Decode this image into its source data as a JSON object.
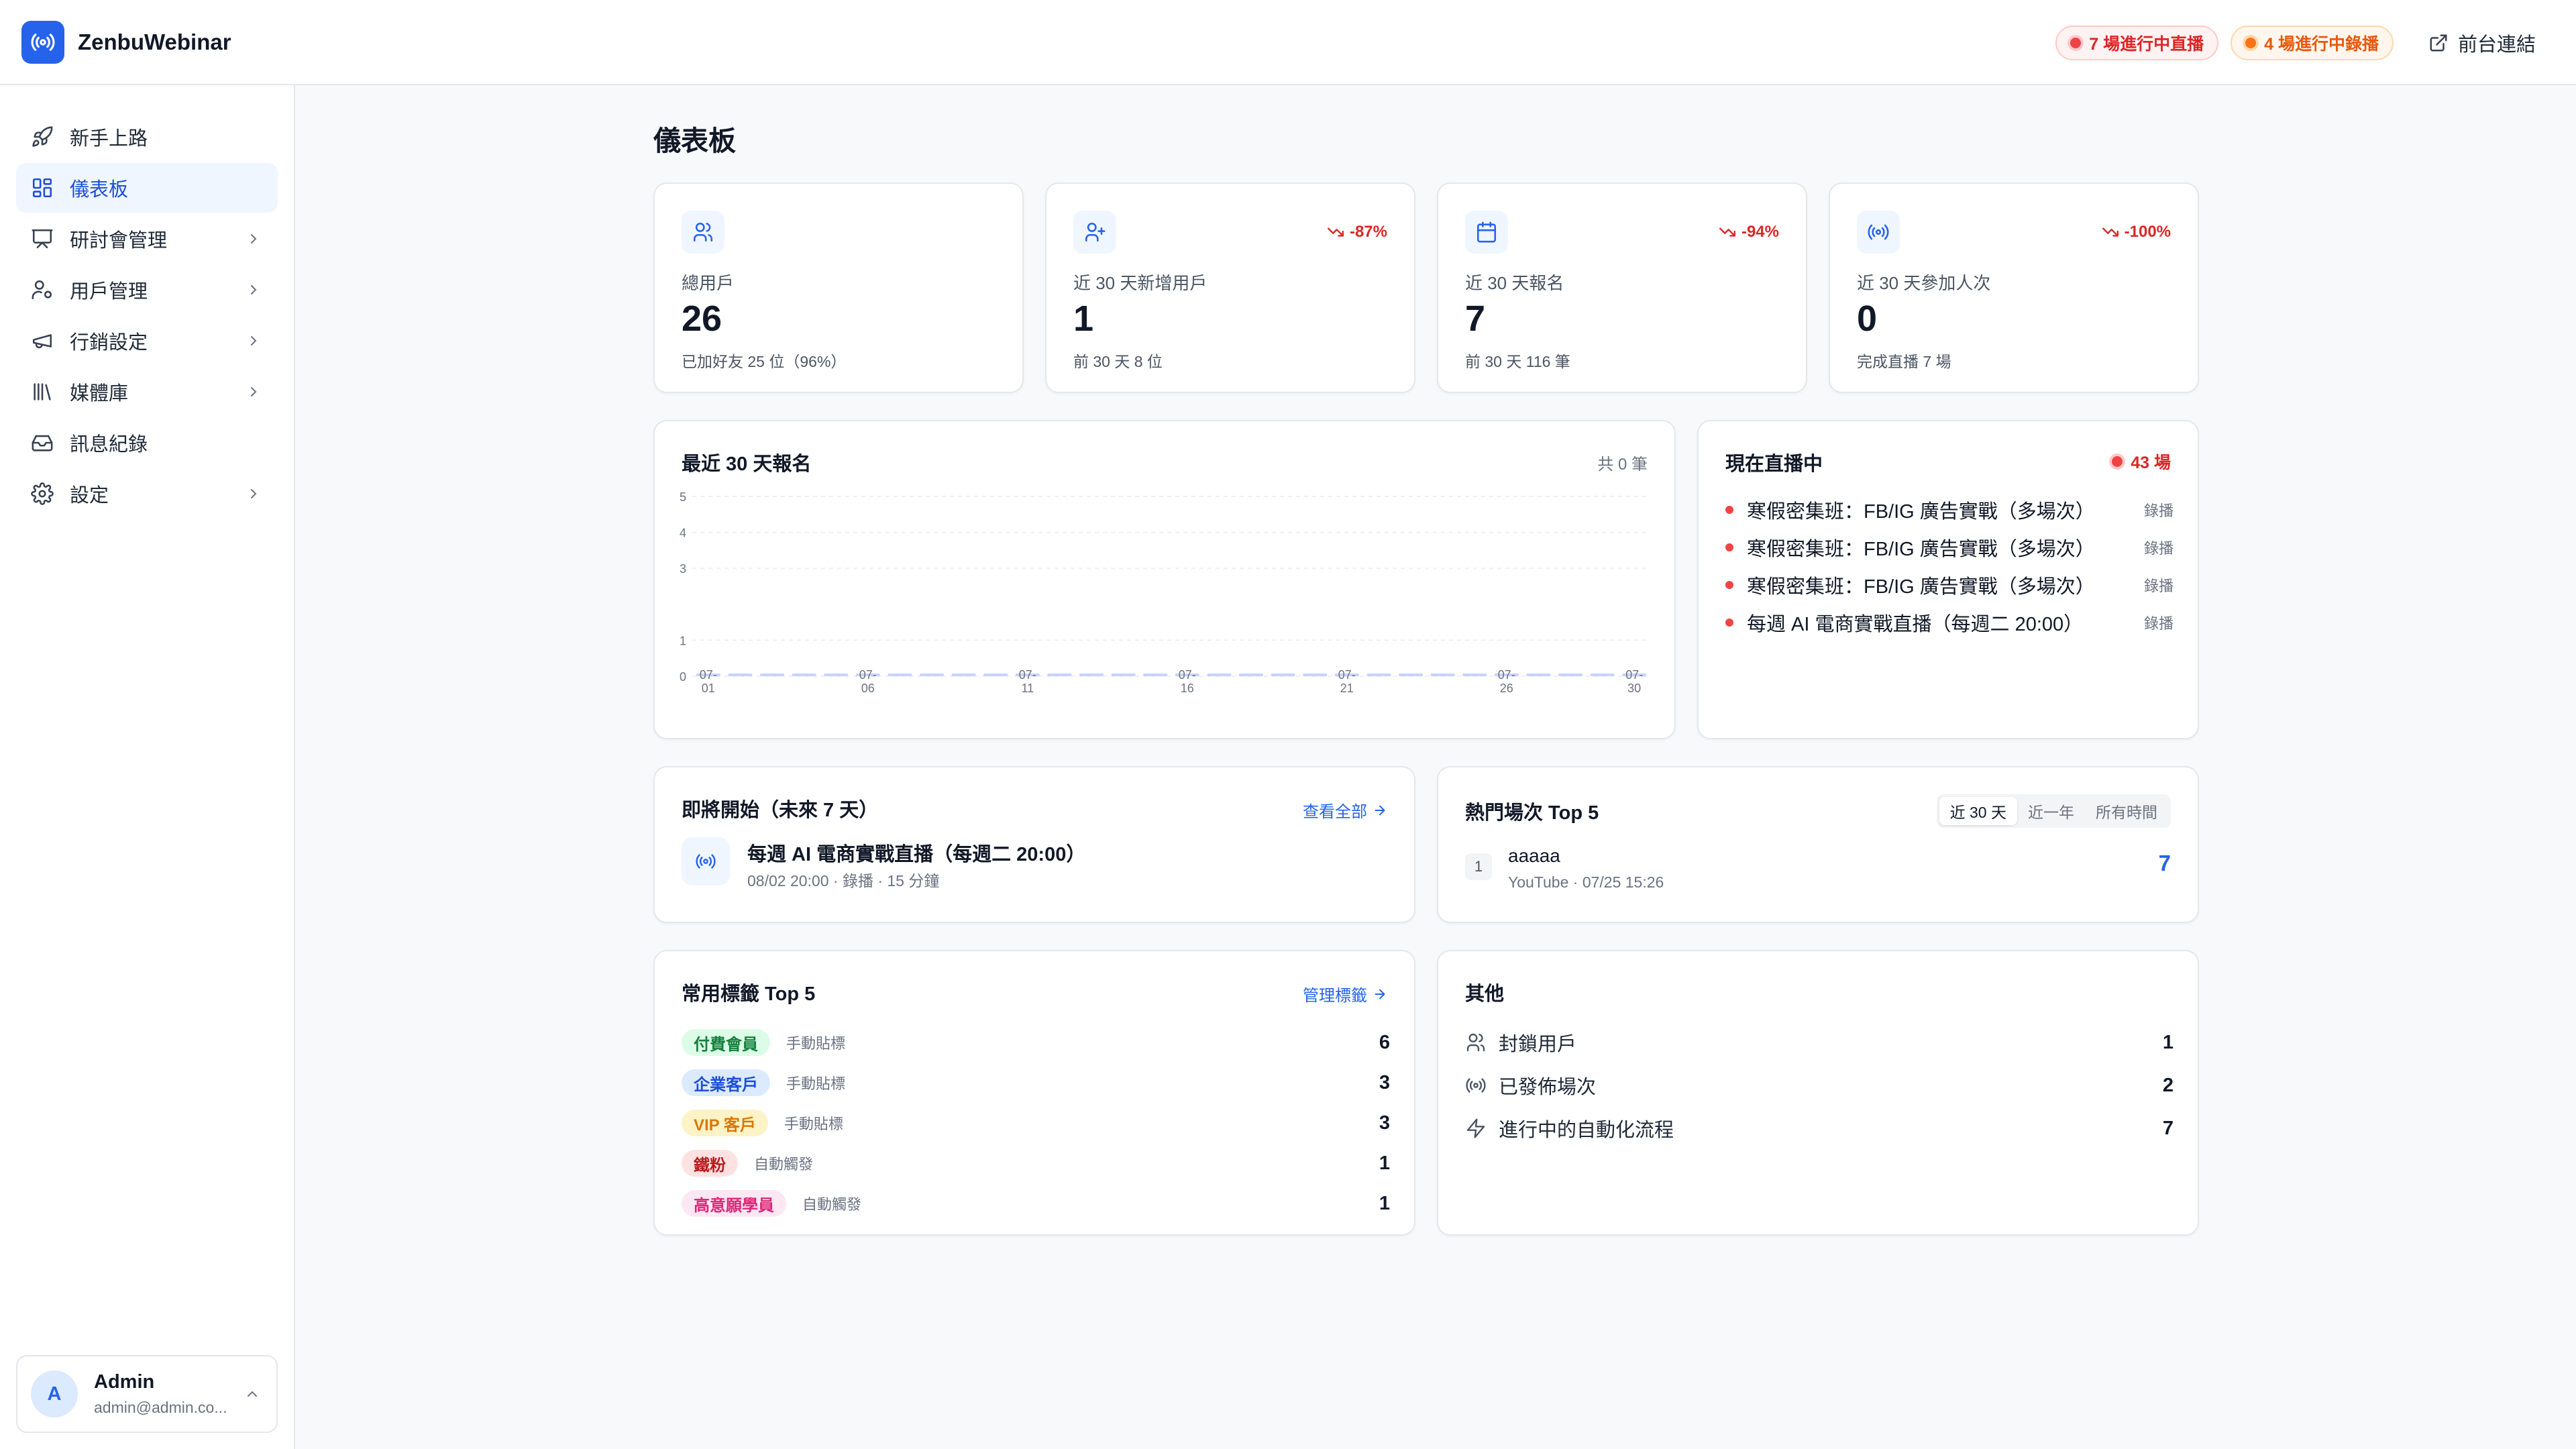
{
  "app": {
    "name": "ZenbuWebinar"
  },
  "header": {
    "live_pill": "7 場進行中直播",
    "recording_pill": "4 場進行中錄播",
    "front_link": "前台連結"
  },
  "sidebar": {
    "items": [
      {
        "label": "新手上路",
        "icon": "rocket-icon",
        "active": false,
        "has_children": false
      },
      {
        "label": "儀表板",
        "icon": "grid-icon",
        "active": true,
        "has_children": false
      },
      {
        "label": "研討會管理",
        "icon": "presentation-icon",
        "active": false,
        "has_children": true
      },
      {
        "label": "用戶管理",
        "icon": "user-cog-icon",
        "active": false,
        "has_children": true
      },
      {
        "label": "行銷設定",
        "icon": "megaphone-icon",
        "active": false,
        "has_children": true
      },
      {
        "label": "媒體庫",
        "icon": "library-icon",
        "active": false,
        "has_children": true
      },
      {
        "label": "訊息紀錄",
        "icon": "inbox-icon",
        "active": false,
        "has_children": false
      },
      {
        "label": "設定",
        "icon": "gear-icon",
        "active": false,
        "has_children": true
      }
    ],
    "user": {
      "initial": "A",
      "name": "Admin",
      "email": "admin@admin.co..."
    }
  },
  "page": {
    "title": "儀表板"
  },
  "stats": [
    {
      "icon": "users-icon",
      "label": "總用戶",
      "value": "26",
      "sub": "已加好友 25 位（96%）",
      "trend": ""
    },
    {
      "icon": "user-plus-icon",
      "label": "近 30 天新增用戶",
      "value": "1",
      "sub": "前 30 天 8 位",
      "trend": "-87%"
    },
    {
      "icon": "calendar-icon",
      "label": "近 30 天報名",
      "value": "7",
      "sub": "前 30 天 116 筆",
      "trend": "-94%"
    },
    {
      "icon": "broadcast-icon",
      "label": "近 30 天參加人次",
      "value": "0",
      "sub": "完成直播 7 場",
      "trend": "-100%"
    }
  ],
  "registrations_card": {
    "title": "最近 30 天報名",
    "total": "共 0 筆"
  },
  "chart_data": {
    "type": "bar",
    "title": "最近 30 天報名",
    "xlabel": "",
    "ylabel": "",
    "ylim": [
      0,
      5
    ],
    "yticks": [
      0,
      1,
      3,
      4,
      5
    ],
    "x_tick_labels": [
      "07-01",
      "07-06",
      "07-11",
      "07-16",
      "07-21",
      "07-26",
      "07-30"
    ],
    "categories": [
      "07-01",
      "07-02",
      "07-03",
      "07-04",
      "07-05",
      "07-06",
      "07-07",
      "07-08",
      "07-09",
      "07-10",
      "07-11",
      "07-12",
      "07-13",
      "07-14",
      "07-15",
      "07-16",
      "07-17",
      "07-18",
      "07-19",
      "07-20",
      "07-21",
      "07-22",
      "07-23",
      "07-24",
      "07-25",
      "07-26",
      "07-27",
      "07-28",
      "07-29",
      "07-30"
    ],
    "values": [
      0,
      0,
      0,
      0,
      0,
      0,
      0,
      0,
      0,
      0,
      0,
      0,
      0,
      0,
      0,
      0,
      0,
      0,
      0,
      0,
      0,
      0,
      0,
      0,
      0,
      0,
      0,
      0,
      0,
      0
    ],
    "grid": true,
    "bar_color": "#c7d2fe"
  },
  "live_now": {
    "title": "現在直播中",
    "count": "43 場",
    "items": [
      {
        "name": "寒假密集班：FB/IG 廣告實戰（多場次）",
        "type": "錄播"
      },
      {
        "name": "寒假密集班：FB/IG 廣告實戰（多場次）",
        "type": "錄播"
      },
      {
        "name": "寒假密集班：FB/IG 廣告實戰（多場次）",
        "type": "錄播"
      },
      {
        "name": "每週 AI 電商實戰直播（每週二 20:00）",
        "type": "錄播"
      }
    ]
  },
  "upcoming": {
    "title": "即將開始（未來 7 天）",
    "view_all": "查看全部",
    "items": [
      {
        "title": "每週 AI 電商實戰直播（每週二 20:00）",
        "meta": "08/02 20:00 · 錄播 · 15 分鐘"
      }
    ]
  },
  "top_sessions": {
    "title": "熱門場次 Top 5",
    "tabs": [
      "近 30 天",
      "近一年",
      "所有時間"
    ],
    "active_tab": 0,
    "items": [
      {
        "rank": "1",
        "name": "aaaaa",
        "meta": "YouTube · 07/25 15:26",
        "count": "7"
      }
    ]
  },
  "tags": {
    "title": "常用標籤 Top 5",
    "manage": "管理標籤",
    "items": [
      {
        "name": "付費會員",
        "kind": "手動貼標",
        "count": "6",
        "bg": "#dcfce7",
        "fg": "#15803d"
      },
      {
        "name": "企業客戶",
        "kind": "手動貼標",
        "count": "3",
        "bg": "#dbeafe",
        "fg": "#1d4ed8"
      },
      {
        "name": "VIP 客戶",
        "kind": "手動貼標",
        "count": "3",
        "bg": "#fef3c7",
        "fg": "#d97706"
      },
      {
        "name": "鐵粉",
        "kind": "自動觸發",
        "count": "1",
        "bg": "#fee2e2",
        "fg": "#b91c1c"
      },
      {
        "name": "高意願學員",
        "kind": "自動觸發",
        "count": "1",
        "bg": "#fce7f3",
        "fg": "#db2777"
      }
    ]
  },
  "other": {
    "title": "其他",
    "items": [
      {
        "icon": "users-icon",
        "label": "封鎖用戶",
        "count": "1"
      },
      {
        "icon": "broadcast-icon",
        "label": "已發佈場次",
        "count": "2"
      },
      {
        "icon": "lightning-icon",
        "label": "進行中的自動化流程",
        "count": "7"
      }
    ]
  },
  "colors": {
    "accent": "#2563eb",
    "danger": "#dc2626",
    "warning": "#ea580c"
  }
}
